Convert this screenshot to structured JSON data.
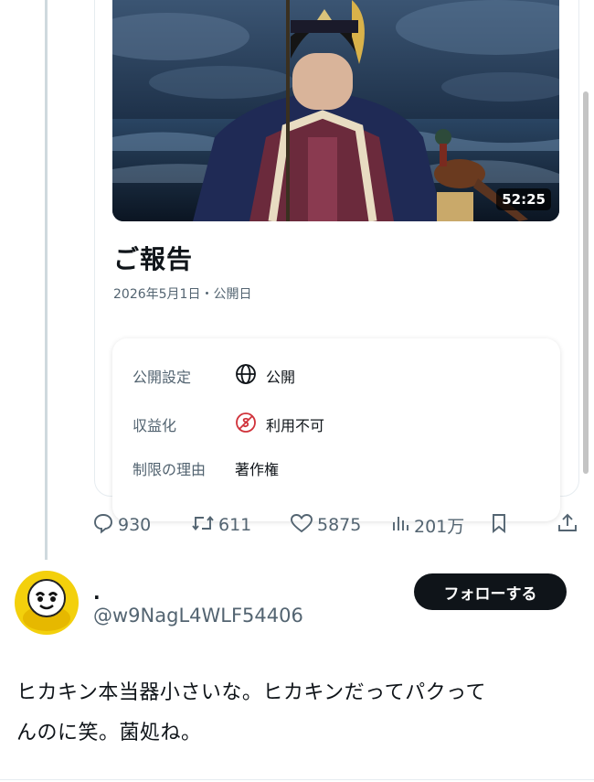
{
  "video": {
    "duration": "52:25",
    "title": "ご報告",
    "date": "2026年5月1日・公開日"
  },
  "details": {
    "visibility_label": "公開設定",
    "visibility_value": "公開",
    "monetization_label": "収益化",
    "monetization_value": "利用不可",
    "restriction_label": "制限の理由",
    "restriction_value": "著作権"
  },
  "actions": {
    "replies": "930",
    "reposts": "611",
    "likes": "5875",
    "views": "201万"
  },
  "reply": {
    "display_name": ".",
    "handle": "@w9NagL4WLF54406",
    "follow_label": "フォローする",
    "text_line1": "ヒカキン本当器小さいな。ヒカキンだってパクって",
    "text_line2": "んのに笑。菌処ね。"
  },
  "colors": {
    "text_primary": "#0f1419",
    "text_secondary": "#536471",
    "monetization_icon": "#d0323a",
    "avatar_yellow": "#f3d00c"
  },
  "icons": [
    "reply-icon",
    "repost-icon",
    "like-icon",
    "views-icon",
    "bookmark-icon",
    "share-icon",
    "globe-icon",
    "no-money-icon"
  ]
}
